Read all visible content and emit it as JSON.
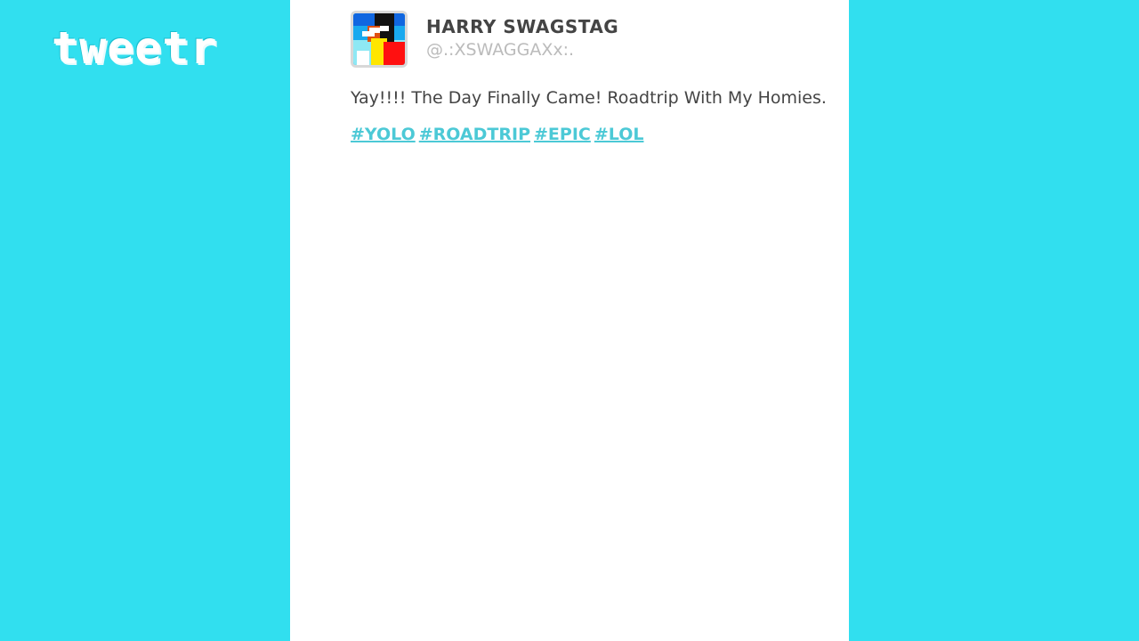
{
  "app": {
    "logo_text": "tweetr"
  },
  "colors": {
    "background": "#31dfef",
    "panel": "#ffffff",
    "name": "#444444",
    "handle": "#bbbbbb",
    "hashtag": "#4cc9d6"
  },
  "tweet": {
    "avatar_icon": "user-avatar-icon",
    "user_name": "HARRY SWAGSTAG",
    "user_handle": "@.:XSWAGGAXx:.",
    "text": "Yay!!!! The Day Finally Came! Roadtrip With My Homies.",
    "hashtags": [
      "#YOLO",
      "#ROADTRIP",
      "#EPIC",
      "#LOL"
    ]
  }
}
